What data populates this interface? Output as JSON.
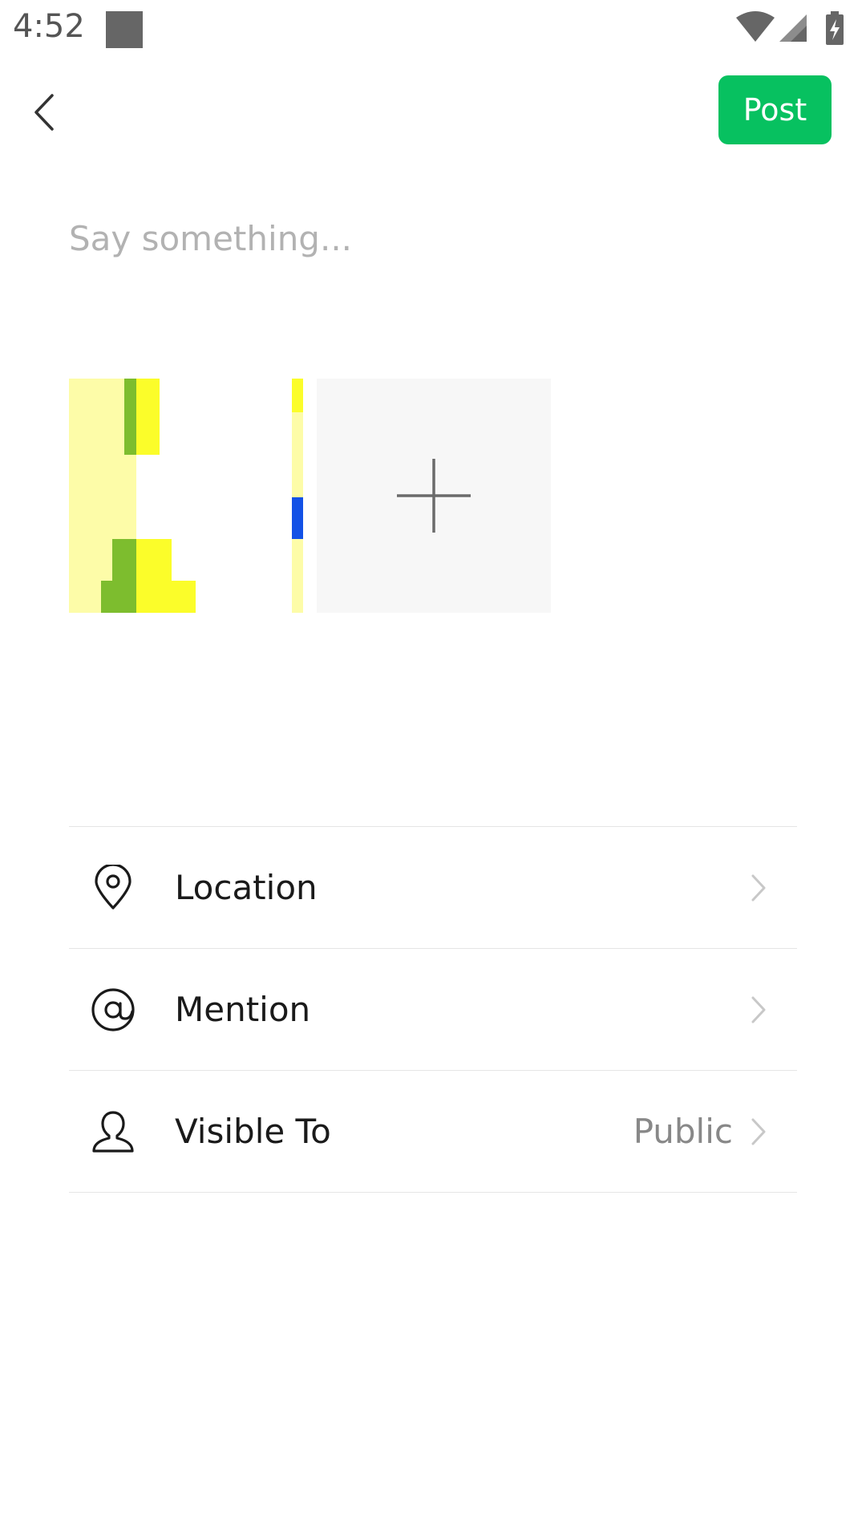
{
  "status_bar": {
    "time": "4:52"
  },
  "header": {
    "back_icon": "chevron-left-icon",
    "post_label": "Post",
    "post_color": "#07c160"
  },
  "compose": {
    "placeholder": "Say something...",
    "value": ""
  },
  "media": {
    "add_icon": "plus-icon",
    "thumbnail_colors": [
      "#fdfca8",
      "#7dbd2e",
      "#fbfd2a",
      "#1351e6"
    ]
  },
  "options": {
    "location": {
      "label": "Location",
      "icon": "location-pin-icon"
    },
    "mention": {
      "label": "Mention",
      "icon": "at-sign-icon"
    },
    "visible_to": {
      "label": "Visible To",
      "value": "Public",
      "icon": "person-icon"
    }
  }
}
